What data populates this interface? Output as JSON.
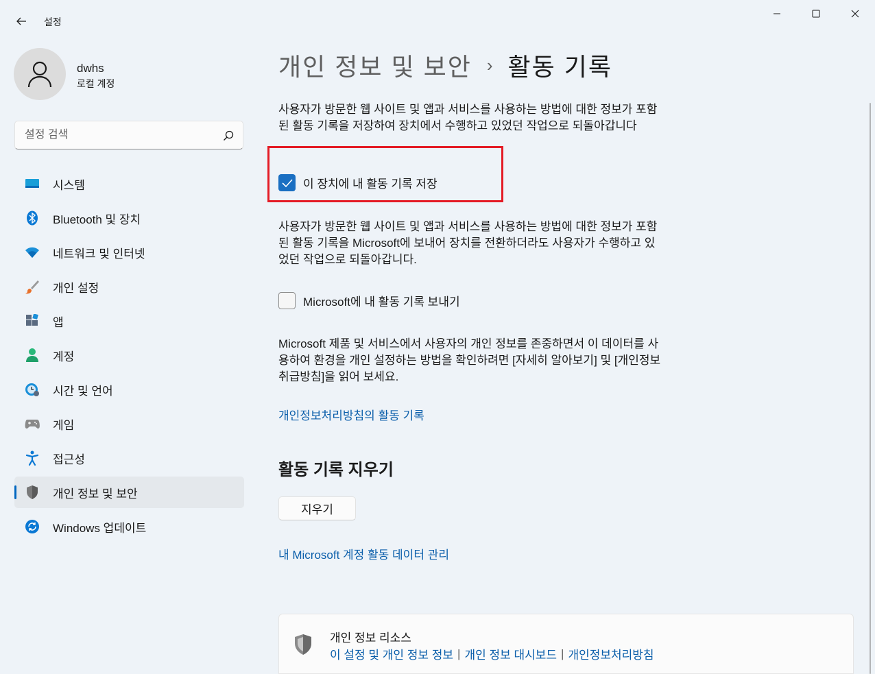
{
  "window": {
    "app_title": "설정",
    "controls": {
      "minimize": "minimize-icon",
      "maximize": "maximize-icon",
      "close": "close-icon"
    }
  },
  "profile": {
    "name": "dwhs",
    "account_type": "로컬 계정"
  },
  "search": {
    "placeholder": "설정 검색"
  },
  "sidebar": {
    "items": [
      {
        "label": "시스템",
        "icon": "system-icon",
        "active": false
      },
      {
        "label": "Bluetooth 및 장치",
        "icon": "bluetooth-icon",
        "active": false
      },
      {
        "label": "네트워크 및 인터넷",
        "icon": "wifi-icon",
        "active": false
      },
      {
        "label": "개인 설정",
        "icon": "brush-icon",
        "active": false
      },
      {
        "label": "앱",
        "icon": "apps-icon",
        "active": false
      },
      {
        "label": "계정",
        "icon": "account-icon",
        "active": false
      },
      {
        "label": "시간 및 언어",
        "icon": "time-language-icon",
        "active": false
      },
      {
        "label": "게임",
        "icon": "gamepad-icon",
        "active": false
      },
      {
        "label": "접근성",
        "icon": "accessibility-icon",
        "active": false
      },
      {
        "label": "개인 정보 및 보안",
        "icon": "shield-icon",
        "active": true
      },
      {
        "label": "Windows 업데이트",
        "icon": "update-icon",
        "active": false
      }
    ]
  },
  "breadcrumb": {
    "parent": "개인 정보 및 보안",
    "separator": "›",
    "current": "활동 기록"
  },
  "content": {
    "para1": "사용자가 방문한 웹 사이트 및 앱과 서비스를 사용하는 방법에 대한 정보가 포함된 활동 기록을 저장하여 장치에서 수행하고 있었던 작업으로 되돌아갑니다",
    "checkbox1": {
      "label": "이 장치에 내 활동 기록 저장",
      "checked": true
    },
    "para2": "사용자가 방문한 웹 사이트 및 앱과 서비스를 사용하는 방법에 대한 정보가 포함된 활동 기록을 Microsoft에 보내어 장치를 전환하더라도 사용자가 수행하고 있었던 작업으로 되돌아갑니다.",
    "checkbox2": {
      "label": "Microsoft에 내 활동 기록 보내기",
      "checked": false
    },
    "para3": "Microsoft 제품 및 서비스에서 사용자의 개인 정보를 존중하면서 이 데이터를 사용하여 환경을 개인 설정하는 방법을 확인하려면 [자세히 알아보기] 및 [개인정보취급방침]을 읽어 보세요.",
    "privacy_link": "개인정보처리방침의 활동 기록",
    "clear_section_title": "활동 기록 지우기",
    "clear_button": "지우기",
    "manage_link": "내 Microsoft 계정 활동 데이터 관리"
  },
  "resources": {
    "title": "개인 정보 리소스",
    "links": [
      "이 설정 및 개인 정보 정보",
      "개인 정보 대시보드",
      "개인정보처리방침"
    ],
    "separator": "|"
  },
  "colors": {
    "accent": "#1a6fc2",
    "link": "#0a5eaa",
    "highlight": "#e41b25"
  }
}
